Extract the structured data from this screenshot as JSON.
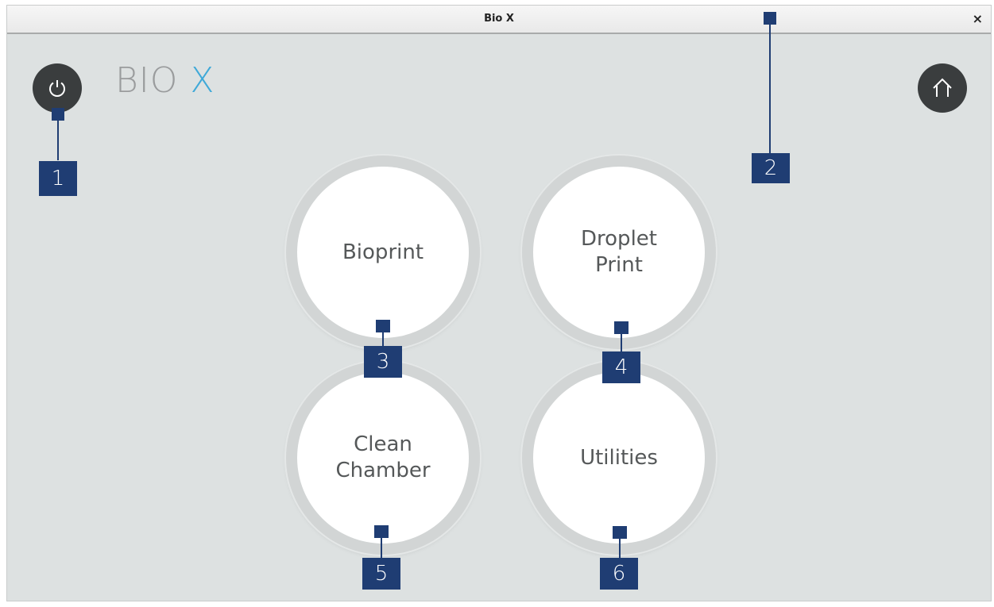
{
  "window": {
    "title": "Bio X",
    "close_glyph": "×"
  },
  "logo": {
    "part1": "BIO",
    "part2": "X"
  },
  "toolbar": {
    "power_icon": "power-icon",
    "home_icon": "home-icon"
  },
  "menu": {
    "bioprint": "Bioprint",
    "droplet_print": "Droplet\nPrint",
    "clean_chamber": "Clean\nChamber",
    "utilities": "Utilities"
  },
  "callouts": [
    "1",
    "2",
    "3",
    "4",
    "5",
    "6"
  ],
  "colors": {
    "background": "#dde1e1",
    "dark_button": "#3a3d3e",
    "logo_accent": "#3fa9d8",
    "callout": "#1f3d73"
  }
}
